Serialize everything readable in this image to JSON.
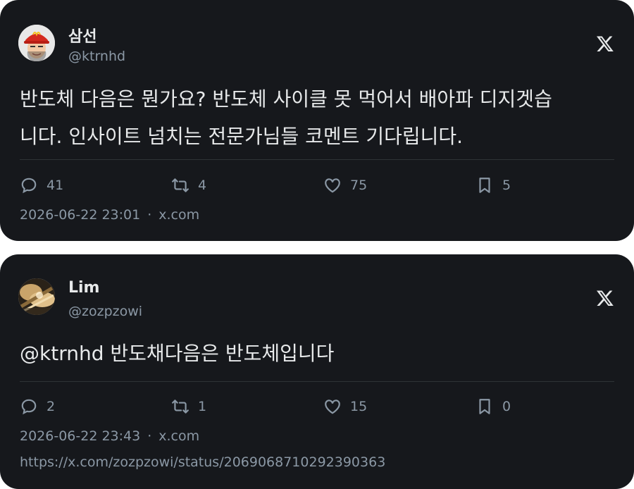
{
  "tweets": [
    {
      "author": {
        "name": "삼선",
        "handle": "@ktrnhd"
      },
      "lines": [
        "반도체 다음은 뭔가요? 반도체 사이클 못 먹어서 배아파 디지겟습",
        "니다. 인사이트 넘치는 전문가님들 코멘트 기다립니다."
      ],
      "replies": "41",
      "reposts": "4",
      "likes": "75",
      "bookmarks": "5",
      "timestamp": "2026-06-22 23:01",
      "dot": "·",
      "source": "x.com"
    },
    {
      "author": {
        "name": "Lim",
        "handle": "@zozpzowi"
      },
      "lines": [
        "@ktrnhd 반도채다음은 반도체입니다"
      ],
      "replies": "2",
      "reposts": "1",
      "likes": "15",
      "bookmarks": "0",
      "timestamp": "2026-06-22 23:43",
      "dot": "·",
      "source": "x.com",
      "url": "https://x.com/zozpzowi/status/2069068710292390363"
    }
  ],
  "icons": {
    "reply": "speech-bubble-icon",
    "repost": "repost-arrows-icon",
    "like": "heart-icon",
    "bookmark": "bookmark-icon",
    "brand": "x-logo-icon"
  },
  "colors": {
    "card_bg": "#16181c",
    "text_primary": "#e7e9ea",
    "text_secondary": "#8b98a5",
    "divider": "#2f3336"
  }
}
